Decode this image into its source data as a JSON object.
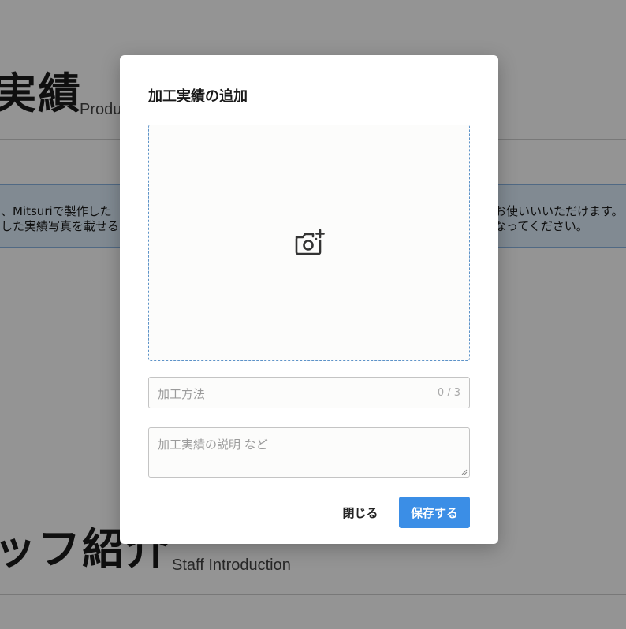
{
  "background": {
    "section1": {
      "title": "実績",
      "subtitle": "Produ"
    },
    "notice": {
      "line1_left": "、Mitsuriで製作した",
      "line2_left": "した実績写真を載せる",
      "line1_right": "お使いいいただけます。",
      "line2_right": "なってください。"
    },
    "section2": {
      "title": "ッフ紹介",
      "subtitle": "Staff Introduction"
    }
  },
  "modal": {
    "title": "加工実績の追加",
    "photo_upload": {
      "icon": "add-photo-camera-icon"
    },
    "method_input": {
      "placeholder": "加工方法",
      "counter": "0 / 3"
    },
    "description_input": {
      "placeholder": "加工実績の説明 など"
    },
    "buttons": {
      "close_label": "閉じる",
      "save_label": "保存する"
    }
  },
  "colors": {
    "accent": "#3b8ee6",
    "overlay": "rgba(0,0,0,0.42)",
    "dropzone_border": "#5d93c9"
  }
}
